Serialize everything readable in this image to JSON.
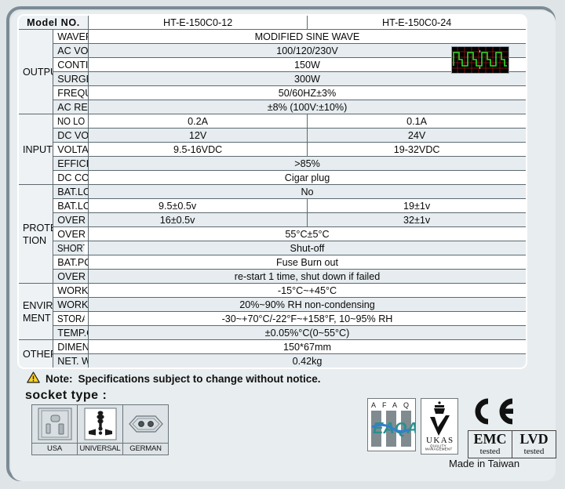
{
  "table": {
    "header": {
      "title": "Model NO.",
      "model_a": "HT-E-150C0-12",
      "model_b": "HT-E-150C0-24"
    },
    "groups": [
      {
        "name": "OUTPUT",
        "rows": [
          {
            "param": "WAVEFORM",
            "span": true,
            "value": "MODIFIED SINE WAVE"
          },
          {
            "param": "AC VOLTAGE",
            "span": true,
            "value": "100/120/230V"
          },
          {
            "param": "CONTINUOUS POWER",
            "span": true,
            "value": "150W"
          },
          {
            "param": "SURGE POWER",
            "span": true,
            "value": "300W"
          },
          {
            "param": "FREQUENCY",
            "span": true,
            "value": "50/60HZ±3%"
          },
          {
            "param": "AC REGULATION",
            "span": true,
            "value": "±8% (100V:±10%)"
          }
        ]
      },
      {
        "name": "INPUT",
        "rows": [
          {
            "param": "NO LOAD CURRENT DRAW",
            "condensed": true,
            "span": false,
            "value_a": "0.2A",
            "value_b": "0.1A"
          },
          {
            "param": "DC VOLTAGE",
            "span": false,
            "value_a": "12V",
            "value_b": "24V"
          },
          {
            "param": "VOLTAGE RANGE",
            "span": false,
            "value_a": "9.5-16VDC",
            "value_b": "19-32VDC"
          },
          {
            "param": "EFFICIENCY",
            "span": true,
            "value": ">85%"
          },
          {
            "param": "DC CONNECTOR",
            "span": true,
            "value": "Cigar plug"
          }
        ]
      },
      {
        "name": "PROTEC-TION",
        "rows": [
          {
            "param": "BAT.LOW ALARM",
            "span": true,
            "value": "No"
          },
          {
            "param": "BAT.LOW SHUTDOWN",
            "span": false,
            "value_a": "9.5±0.5v",
            "value_b": "19±1v",
            "offset": true
          },
          {
            "param": "OVER VOLTAGE",
            "span": false,
            "value_a": "16±0.5v",
            "value_b": "32±1v",
            "offset": true
          },
          {
            "param": "OVER TEMPERATURE",
            "span": true,
            "value": "55°C±5°C"
          },
          {
            "param": "SHORT CIRCUIT PROTECTION",
            "condensed": true,
            "span": true,
            "value": "Shut-off"
          },
          {
            "param": "BAT.POLARITY",
            "span": true,
            "value": "Fuse Burn out"
          },
          {
            "param": "OVER LOAD",
            "span": true,
            "value": "re-start 1 time, shut down if failed"
          }
        ]
      },
      {
        "name": "ENVIRON-MENT",
        "rows": [
          {
            "param": "WORKING TEMP.",
            "span": true,
            "value": "-15°C~+45°C"
          },
          {
            "param": "WORKING HUMIDITY",
            "span": true,
            "value": "20%~90% RH non-condensing"
          },
          {
            "param": "STORAGE TEMP., HUMIDITY",
            "condensed": true,
            "span": true,
            "value": "-30~+70°C/-22°F~+158°F, 10~95% RH"
          },
          {
            "param": "TEMP.COEFFICIENT",
            "span": true,
            "value": "±0.05%°C(0~55°C)"
          }
        ]
      },
      {
        "name": "OTHERS",
        "rows": [
          {
            "param": "DIMENSION(L*W*H)",
            "span": true,
            "value": "150*67mm"
          },
          {
            "param": "NET. WEIGHT",
            "span": true,
            "value": "0.42kg"
          }
        ]
      }
    ]
  },
  "note": {
    "label": "Note:",
    "text": "Specifications subject to change without notice."
  },
  "socket": {
    "title": "socket type :",
    "types": [
      {
        "label": "USA",
        "icon": "usa-socket-icon"
      },
      {
        "label": "UNIVERSAL",
        "icon": "universal-socket-icon"
      },
      {
        "label": "GERMAN",
        "icon": "german-socket-icon"
      }
    ]
  },
  "certs": {
    "afaq": {
      "letters": [
        "A",
        "F",
        "A",
        "Q"
      ],
      "wordmark": "EAQA"
    },
    "ukas": {
      "name": "UKAS",
      "line1": "QUALITY",
      "line2": "MANAGEMENT"
    },
    "ce": "CE",
    "marks": [
      {
        "name": "EMC",
        "sub": "tested"
      },
      {
        "name": "LVD",
        "sub": "tested"
      }
    ]
  },
  "made_in": "Made in Taiwan",
  "colors": {
    "page_bg": "#dfe4e7",
    "frame": "#7c8b95",
    "row_alt": "#e6ecef",
    "group_bg": "#eef2f4",
    "scope_trace": "#2bdc2b",
    "scope_grid": "#7a1212",
    "warning": "#ffd21f"
  }
}
